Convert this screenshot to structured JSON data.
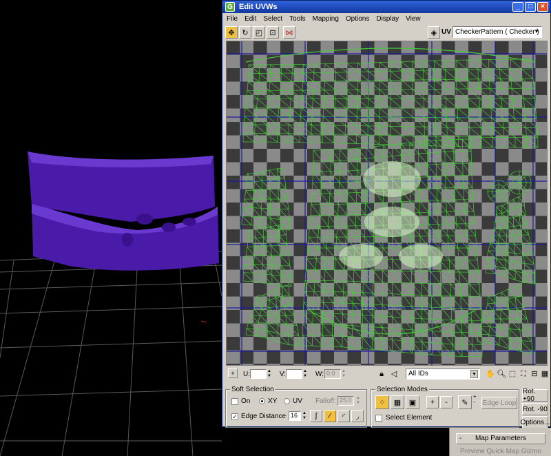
{
  "window": {
    "title": "Edit UVWs",
    "app_icon_glyph": "G",
    "controls": [
      "_",
      "□",
      "×"
    ]
  },
  "menu": [
    "File",
    "Edit",
    "Select",
    "Tools",
    "Mapping",
    "Options",
    "Display",
    "View"
  ],
  "toolbar": {
    "uv_label": "UV",
    "texture_dropdown": "CheckerPattern  ( Checker )"
  },
  "coords": {
    "u_label": "U:",
    "v_label": "V:",
    "w_label": "W:",
    "w_value": "0.0",
    "id_dropdown": "All IDs"
  },
  "soft_selection": {
    "title": "Soft Selection",
    "on_label": "On",
    "xy_label": "XY",
    "uv_label": "UV",
    "falloff_label": "Falloff:",
    "falloff_value": "25.0",
    "edge_distance_label": "Edge Distance",
    "edge_distance_checked": true,
    "edge_distance_value": "16"
  },
  "selection_modes": {
    "title": "Selection Modes",
    "plus_label": "+",
    "minus_label": "-",
    "edge_loop_label": "Edge Loop",
    "select_element_label": "Select Element"
  },
  "rotate": {
    "rot_plus": "Rot. +90",
    "rot_minus": "Rot. -90",
    "options": "Options..."
  },
  "rollout": {
    "map_parameters": "Map Parameters",
    "minus": "-",
    "preview": "Preview Quick Map Gizmo"
  },
  "colors": {
    "mesh": "#46c93a",
    "teeth": "#4a1aa8",
    "checker_dark": "#3a3a3a",
    "checker_light": "#8a8a8a",
    "uv_grid": "#1a1aa0",
    "accent": "#f0c040"
  }
}
